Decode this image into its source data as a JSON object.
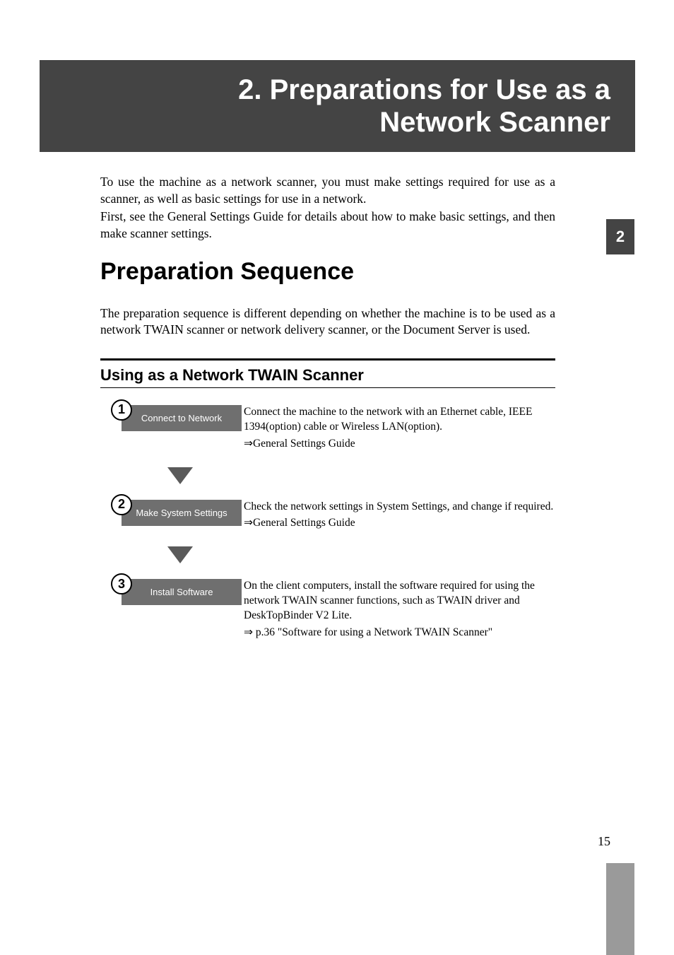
{
  "chapter": {
    "title_line1": "2. Preparations for Use as a",
    "title_line2": "Network Scanner"
  },
  "intro": {
    "paragraph1": "To use the machine as a network scanner, you must make settings required for use as a scanner, as well as basic settings for use in a network.",
    "paragraph2": "First, see the General Settings Guide for details about how to make basic settings, and then make scanner settings."
  },
  "section": {
    "heading": "Preparation Sequence",
    "text": "The preparation sequence is different depending on whether the machine is to be used as a network TWAIN scanner or network delivery scanner, or the Document Server is used."
  },
  "subsection": {
    "heading": "Using as a Network TWAIN Scanner"
  },
  "steps": [
    {
      "number": "1",
      "label": "Connect to Network",
      "description": "Connect the machine to the network with an Ethernet cable, IEEE 1394(option) cable or Wireless LAN(option).",
      "reference": "⇒General Settings Guide"
    },
    {
      "number": "2",
      "label": "Make System Settings",
      "description": "Check the network settings in System Settings, and change if required.",
      "reference": "⇒General Settings Guide"
    },
    {
      "number": "3",
      "label": "Install Software",
      "description": "On the client computers, install the software required for using the network TWAIN scanner functions, such as TWAIN driver and DeskTopBinder V2 Lite.",
      "reference": "⇒ p.36 \"Software for using a Network TWAIN Scanner\""
    }
  ],
  "pageNumber": "15",
  "sideTab": "2"
}
